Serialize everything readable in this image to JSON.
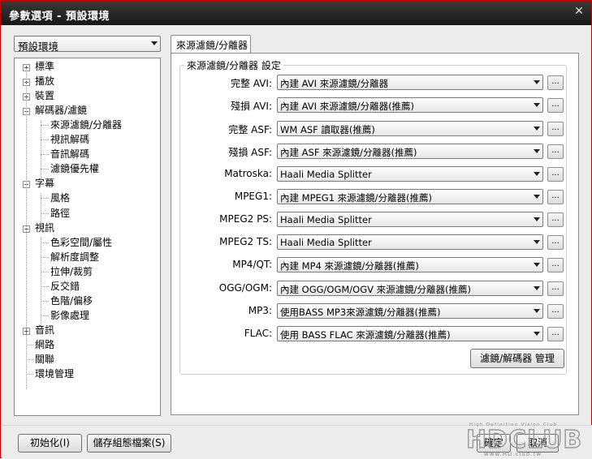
{
  "window": {
    "title": "參數選項 - 預設環境"
  },
  "category_select": {
    "value": "預設環境"
  },
  "tree": {
    "items": [
      {
        "label": "標準",
        "box": "+"
      },
      {
        "label": "播放",
        "box": "+"
      },
      {
        "label": "裝置",
        "box": "+"
      },
      {
        "label": "解碼器/濾鏡",
        "box": "−"
      },
      {
        "label": "來源濾鏡/分離器"
      },
      {
        "label": "視訊解碼"
      },
      {
        "label": "音訊解碼"
      },
      {
        "label": "濾鏡優先權"
      },
      {
        "label": "字幕",
        "box": "−"
      },
      {
        "label": "風格"
      },
      {
        "label": "路徑"
      },
      {
        "label": "視訊",
        "box": "−"
      },
      {
        "label": "色彩空間/屬性"
      },
      {
        "label": "解析度調整"
      },
      {
        "label": "拉伸/裁剪"
      },
      {
        "label": "反交錯"
      },
      {
        "label": "色階/偏移"
      },
      {
        "label": "影像處理"
      },
      {
        "label": "音訊",
        "box": "+"
      },
      {
        "label": "網路"
      },
      {
        "label": "關聯"
      },
      {
        "label": "環境管理"
      }
    ]
  },
  "tab": {
    "label": "來源濾鏡/分離器"
  },
  "group": {
    "label": "來源濾鏡/分離器 設定"
  },
  "rows": [
    {
      "label": "完整 AVI:",
      "value": "內建 AVI 來源濾鏡/分離器"
    },
    {
      "label": "殘損 AVI:",
      "value": "內建 AVI 來源濾鏡/分離器(推薦)"
    },
    {
      "label": "完整 ASF:",
      "value": "WM ASF 讀取器(推薦)"
    },
    {
      "label": "殘損 ASF:",
      "value": "內建 ASF 來源濾鏡/分離器(推薦)"
    },
    {
      "label": "Matroska:",
      "value": "Haali Media Splitter"
    },
    {
      "label": "MPEG1:",
      "value": "內建 MPEG1 來源濾鏡/分離器(推薦)"
    },
    {
      "label": "MPEG2 PS:",
      "value": "Haali Media Splitter"
    },
    {
      "label": "MPEG2 TS:",
      "value": "Haali Media Splitter"
    },
    {
      "label": "MP4/QT:",
      "value": "內建 MP4 來源濾鏡/分離器(推薦)"
    },
    {
      "label": "OGG/OGM:",
      "value": "內建 OGG/OGM/OGV 來源濾鏡/分離器(推薦)"
    },
    {
      "label": "MP3:",
      "value": "使用BASS MP3來源濾鏡/分離器(推薦)"
    },
    {
      "label": "FLAC:",
      "value": "使用 BASS FLAC 來源濾鏡/分離器(推薦)"
    }
  ],
  "dots_label": "...",
  "buttons": {
    "codec_manager": "濾鏡/解碼器 管理",
    "init": "初始化(I)",
    "save": "儲存組態檔案(S)",
    "ok": "確定",
    "cancel": "取消"
  },
  "watermark": {
    "tagline": "High Definition Vision Club",
    "logo_text": "HDCLUB",
    "url": "www.HD.club.tw"
  },
  "colors": {
    "titlebar": "#1e1e1e",
    "window_border": "#c40000",
    "accent": "#2b2b2b"
  }
}
